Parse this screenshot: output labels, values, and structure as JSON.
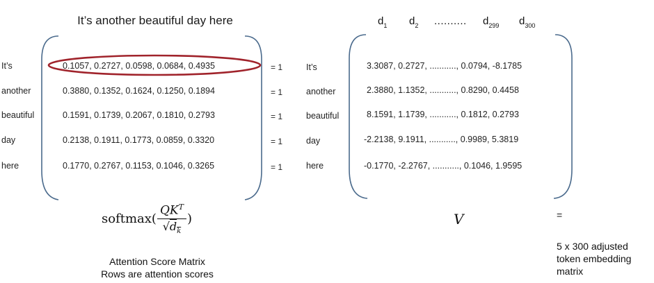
{
  "sentence": "It’s another beautiful day here",
  "tokens": [
    "It’s",
    "another",
    "beautiful",
    "day",
    "here"
  ],
  "attention_rows": [
    "0.1057, 0.2727, 0.0598, 0.0684, 0.4935",
    "0.3880, 0.1352, 0.1624, 0.1250, 0.1894",
    "0.1591, 0.1739, 0.2067, 0.1810, 0.2793",
    "0.2138, 0.1911, 0.1773, 0.0859, 0.3320",
    "0.1770, 0.2767, 0.1153, 0.1046, 0.3265"
  ],
  "row_sum_label": "= 1",
  "v_headers": {
    "d1_base": "d",
    "d1_sub": "1",
    "d2_base": "d",
    "d2_sub": "2",
    "dots": "..........",
    "d299_base": "d",
    "d299_sub": "299",
    "d300_base": "d",
    "d300_sub": "300"
  },
  "v_rows": [
    "3.3087, 0.2727, ..........., 0.0794, -8.1785",
    "2.3880, 1.1352, ..........., 0.8290, 0.4458",
    "8.1591, 1.1739, ..........., 0.1812, 0.2793",
    "-2.2138, 9.1911, ..........., 0.9989, 5.3819",
    "-0.1770, -2.2767, ..........., 0.1046, 1.9595"
  ],
  "formula": {
    "func": "softmax(",
    "numerator": "QK",
    "superscript": "T",
    "sqrt": "√",
    "den_var": "d",
    "den_sub": "k",
    "close": ")"
  },
  "v_symbol": "V",
  "caption_line1": "Attention Score Matrix",
  "caption_line2": "Rows are attention scores",
  "result_equals": "=",
  "result_line1": "5 x 300 adjusted",
  "result_line2": "token embedding",
  "result_line3": "matrix",
  "colors": {
    "bracket": "#4a6a8c",
    "highlight": "#a0232b"
  }
}
